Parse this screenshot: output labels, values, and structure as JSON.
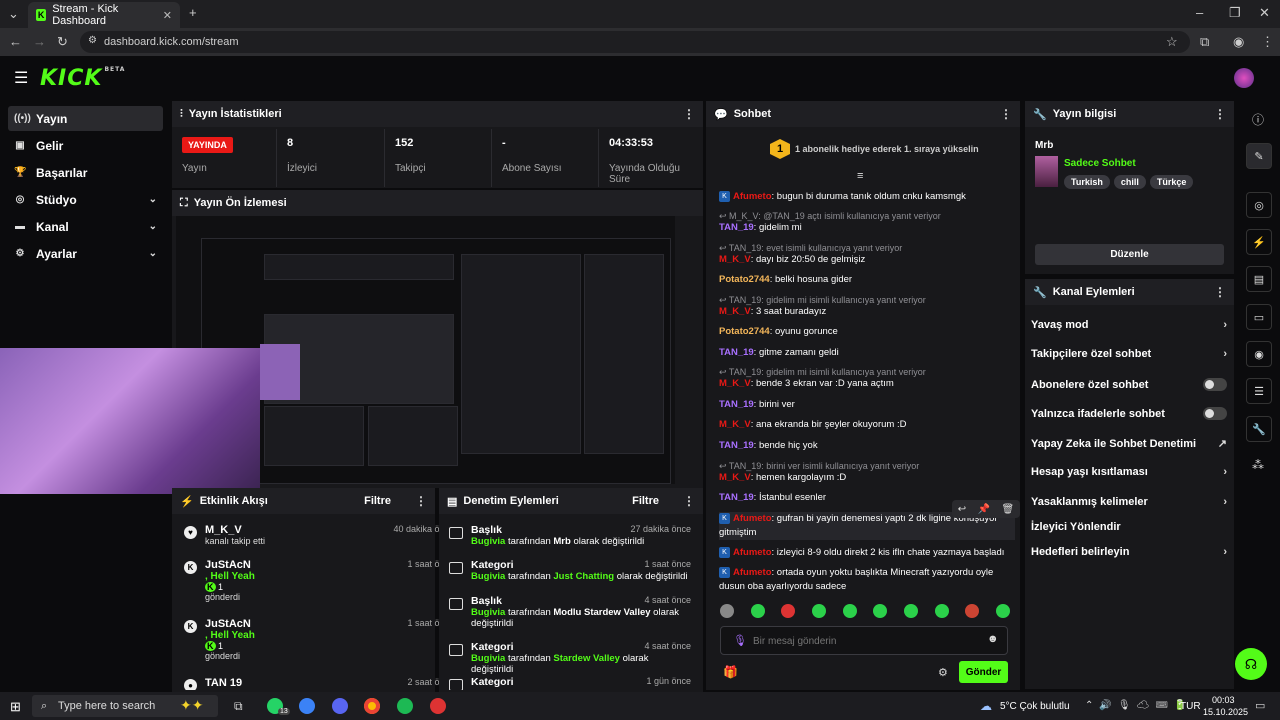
{
  "browser": {
    "tab_title": "Stream - Kick Dashboard",
    "url": "dashboard.kick.com/stream"
  },
  "app": {
    "logo": "KICK",
    "logo_badge": "BETA"
  },
  "sidebar": {
    "items": [
      {
        "label": "Yayın",
        "icon": "broadcast-icon",
        "active": true
      },
      {
        "label": "Gelir",
        "icon": "revenue-icon"
      },
      {
        "label": "Başarılar",
        "icon": "trophy-icon"
      },
      {
        "label": "Stüdyo",
        "icon": "studio-icon",
        "expandable": true
      },
      {
        "label": "Kanal",
        "icon": "channel-icon",
        "expandable": true
      },
      {
        "label": "Ayarlar",
        "icon": "gear-icon",
        "expandable": true
      }
    ]
  },
  "stats": {
    "title": "Yayın İstatistikleri",
    "live_badge": "YAYINDA",
    "live_label": "Yayın",
    "viewers": "8",
    "viewers_label": "İzleyici",
    "followers": "152",
    "followers_label": "Takipçi",
    "subs": "-",
    "subs_label": "Abone Sayısı",
    "duration": "04:33:53",
    "duration_label": "Yayında Olduğu Süre"
  },
  "preview": {
    "title": "Yayın Ön İzlemesi"
  },
  "activity": {
    "title": "Etkinlik Akışı",
    "filter": "Filtre",
    "events": [
      {
        "name": "M_K_V",
        "sub": "kanalı takip etti",
        "time": "40 dakika önce"
      },
      {
        "name": "JuStAcN",
        "extra": ", Hell Yeah",
        "count": "1",
        "sub": "gönderdi",
        "time": "1 saat önce"
      },
      {
        "name": "JuStAcN",
        "extra": ", Hell Yeah",
        "count": "1",
        "sub": "gönderdi",
        "time": "1 saat önce"
      },
      {
        "name": "TAN 19",
        "time": "2 saat önce"
      }
    ]
  },
  "moderation": {
    "title": "Denetim Eylemleri",
    "filter": "Filtre",
    "by": "tarafından",
    "suffix1": "olarak değiştirildi",
    "items": [
      {
        "type": "Başlık",
        "user": "Bugivia",
        "value": "Mrb",
        "time": "27 dakika önce"
      },
      {
        "type": "Kategori",
        "user": "Bugivia",
        "value": "Just Chatting",
        "time": "1 saat önce"
      },
      {
        "type": "Başlık",
        "user": "Bugivia",
        "value": "Modlu Stardew Valley",
        "time": "4 saat önce"
      },
      {
        "type": "Kategori",
        "user": "Bugivia",
        "value": "Stardew Valley",
        "time": "4 saat önce"
      },
      {
        "type": "Kategori",
        "time": "1 gün önce"
      }
    ]
  },
  "chat": {
    "title": "Sohbet",
    "gift_rank": "1",
    "gift_text": "1 abonelik hediye ederek 1. sıraya yükselin",
    "input_placeholder": "Bir mesaj gönderin",
    "send": "Gönder",
    "messages": [
      {
        "user": "Afumeto",
        "color": "#e91916",
        "badge": true,
        "text": ": bugun bi duruma tanık oldum cnku kamsmgk"
      },
      {
        "sys": "M_K_V: @TAN_19 açtı isimli kullanıcıya yanıt veriyor"
      },
      {
        "user": "TAN_19",
        "color": "#a970ff",
        "text": ": gidelim mi"
      },
      {
        "sys": "TAN_19: evet isimli kullanıcıya yanıt veriyor"
      },
      {
        "user": "M_K_V",
        "color": "#e91916",
        "text": ": dayı biz 20:50 de gelmişiz"
      },
      {
        "user": "Potato2744",
        "color": "#f3b65a",
        "text": ": belki hosuna gider"
      },
      {
        "sys": "TAN_19: gidelim mi isimli kullanıcıya yanıt veriyor"
      },
      {
        "user": "M_K_V",
        "color": "#e91916",
        "text": ": 3 saat buradayız"
      },
      {
        "user": "Potato2744",
        "color": "#f3b65a",
        "text": ": oyunu gorunce"
      },
      {
        "user": "TAN_19",
        "color": "#a970ff",
        "text": ": gitme zamanı geldi"
      },
      {
        "sys": "TAN_19: gidelim mi isimli kullanıcıya yanıt veriyor"
      },
      {
        "user": "M_K_V",
        "color": "#e91916",
        "text": ": bende 3 ekran var :D yana açtım"
      },
      {
        "user": "TAN_19",
        "color": "#a970ff",
        "text": ": birini ver"
      },
      {
        "user": "M_K_V",
        "color": "#e91916",
        "text": ": ana ekranda bir şeyler okuyorum :D"
      },
      {
        "user": "TAN_19",
        "color": "#a970ff",
        "text": ": bende hiç yok"
      },
      {
        "sys": "TAN_19: birini ver isimli kullanıcıya yanıt veriyor"
      },
      {
        "user": "M_K_V",
        "color": "#e91916",
        "text": ": hemen kargolayım :D"
      },
      {
        "user": "TAN_19",
        "color": "#a970ff",
        "text": ": İstanbul esenler"
      },
      {
        "user": "Afumeto",
        "color": "#e91916",
        "badge": true,
        "text": ": gufran bi yayin denemesi yaptı 2 dk ligine konuşuyor gitmiştim"
      },
      {
        "user": "Afumeto",
        "color": "#e91916",
        "badge": true,
        "text": ": izleyici 8-9 oldu direkt 2 kis ifln chate yazmaya başladı"
      },
      {
        "user": "Afumeto",
        "color": "#e91916",
        "badge": true,
        "text": ": ortada oyun yoktu başlıkta Minecraft yazıyordu oyle dusun oba ayarlıyordu sadece"
      }
    ]
  },
  "stream_info": {
    "title": "Yayın bilgisi",
    "stream_title": "Mrb",
    "category": "Sadece Sohbet",
    "tags": [
      "Turkish",
      "chill",
      "Türkçe"
    ],
    "edit": "Düzenle"
  },
  "channel_actions": {
    "title": "Kanal Eylemleri",
    "items": [
      {
        "label": "Yavaş mod",
        "kind": "arrow"
      },
      {
        "label": "Takipçilere özel sohbet",
        "kind": "arrow"
      },
      {
        "label": "Abonelere özel sohbet",
        "kind": "toggle"
      },
      {
        "label": "Yalnızca ifadelerle sohbet",
        "kind": "toggle"
      },
      {
        "label": "Yapay Zeka ile Sohbet Denetimi",
        "kind": "external"
      },
      {
        "label": "Hesap yaşı kısıtlaması",
        "kind": "arrow"
      },
      {
        "label": "Yasaklanmış kelimeler",
        "kind": "arrow"
      },
      {
        "label": "İzleyici Yönlendir",
        "kind": "none"
      },
      {
        "label": "Hedefleri belirleyin",
        "kind": "arrow"
      }
    ]
  },
  "taskbar": {
    "search": "Type here to search",
    "weather": "5°C  Çok bulutlu",
    "lang": "TUR",
    "time": "00:03",
    "date": "15.10.2025",
    "whatsapp_badge": "13"
  }
}
